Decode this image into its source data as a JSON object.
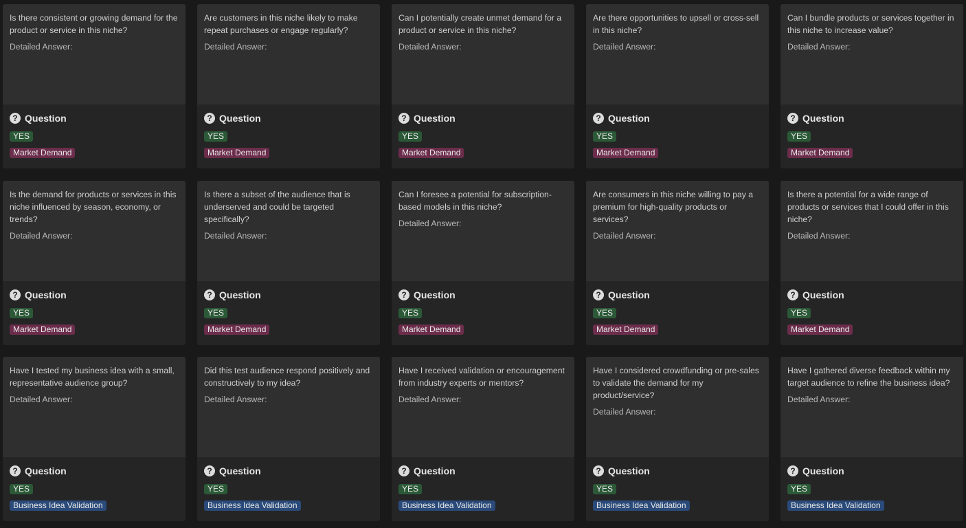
{
  "colors": {
    "background": "#191919",
    "card": "#252525",
    "preview": "#2f2f2f",
    "yes_tag": "#2b5937",
    "market_demand_tag": "#6b2d4b",
    "business_idea_validation_tag": "#2a4a7a"
  },
  "card_title": "Question",
  "answer_label": "Detailed Answer:",
  "icon": "question-circle-icon",
  "cards": [
    {
      "question": "Is there consistent or growing demand for the product or service in this niche?",
      "status": "YES",
      "category": "Market Demand",
      "category_color": "#6b2d4b"
    },
    {
      "question": "Are customers in this niche likely to make repeat purchases or engage regularly?",
      "status": "YES",
      "category": "Market Demand",
      "category_color": "#6b2d4b"
    },
    {
      "question": "Can I potentially create unmet demand for a product or service in this niche?",
      "status": "YES",
      "category": "Market Demand",
      "category_color": "#6b2d4b"
    },
    {
      "question": "Are there opportunities to upsell or cross-sell in this niche?",
      "status": "YES",
      "category": "Market Demand",
      "category_color": "#6b2d4b"
    },
    {
      "question": "Can I bundle products or services together in this niche to increase value?",
      "status": "YES",
      "category": "Market Demand",
      "category_color": "#6b2d4b"
    },
    {
      "question": "Is the demand for products or services in this niche influenced by season, economy, or trends?",
      "status": "YES",
      "category": "Market Demand",
      "category_color": "#6b2d4b"
    },
    {
      "question": "Is there a subset of the audience that is underserved and could be targeted specifically?",
      "status": "YES",
      "category": "Market Demand",
      "category_color": "#6b2d4b"
    },
    {
      "question": "Can I foresee a potential for subscription-based models in this niche?",
      "status": "YES",
      "category": "Market Demand",
      "category_color": "#6b2d4b"
    },
    {
      "question": "Are consumers in this niche willing to pay a premium for high-quality products or services?",
      "status": "YES",
      "category": "Market Demand",
      "category_color": "#6b2d4b"
    },
    {
      "question": "Is there a potential for a wide range of products or services that I could offer in this niche?",
      "status": "YES",
      "category": "Market Demand",
      "category_color": "#6b2d4b"
    },
    {
      "question": "Have I tested my business idea with a small, representative audience group?",
      "status": "YES",
      "category": "Business Idea Validation",
      "category_color": "#2a4a7a"
    },
    {
      "question": "Did this test audience respond positively and constructively to my idea?",
      "status": "YES",
      "category": "Business Idea Validation",
      "category_color": "#2a4a7a"
    },
    {
      "question": "Have I received validation or encouragement from industry experts or mentors?",
      "status": "YES",
      "category": "Business Idea Validation",
      "category_color": "#2a4a7a"
    },
    {
      "question": "Have I considered crowdfunding or pre-sales to validate the demand for my product/service?",
      "status": "YES",
      "category": "Business Idea Validation",
      "category_color": "#2a4a7a"
    },
    {
      "question": "Have I gathered diverse feedback within my target audience to refine the business idea?",
      "status": "YES",
      "category": "Business Idea Validation",
      "category_color": "#2a4a7a"
    }
  ]
}
